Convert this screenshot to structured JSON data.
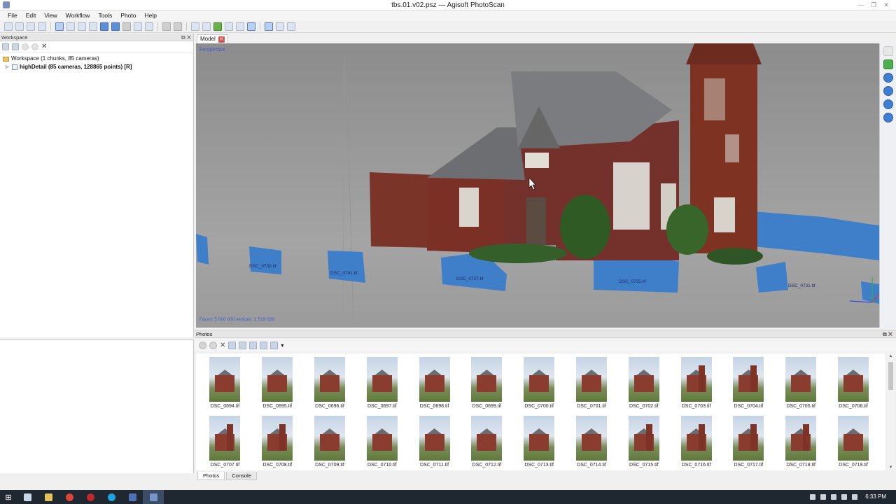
{
  "window": {
    "title": "tbs.01.v02.psz — Agisoft PhotoScan"
  },
  "menu": [
    "File",
    "Edit",
    "View",
    "Workflow",
    "Tools",
    "Photo",
    "Help"
  ],
  "workspace": {
    "panel_title": "Workspace",
    "root_label": "Workspace (1 chunks, 85 cameras)",
    "chunk_label": "highDetail (85 cameras, 128865 points) [R]"
  },
  "model": {
    "tab_label": "Model",
    "projection": "Perspective",
    "stats": "Faces: 5 000 000 vertices: 2 519 089",
    "camera_labels": [
      "DSC_0730.tif",
      "DSC_0741.tif",
      "DSC_0727.tif",
      "DSC_0725.tif",
      "DSC_0721.tif"
    ]
  },
  "photos": {
    "panel_title": "Photos",
    "items": [
      {
        "name": "DSC_0694.tif",
        "tower": false
      },
      {
        "name": "DSC_0695.tif",
        "tower": false
      },
      {
        "name": "DSC_0696.tif",
        "tower": false
      },
      {
        "name": "DSC_0697.tif",
        "tower": false
      },
      {
        "name": "DSC_0698.tif",
        "tower": false
      },
      {
        "name": "DSC_0699.tif",
        "tower": false
      },
      {
        "name": "DSC_0700.tif",
        "tower": false
      },
      {
        "name": "DSC_0701.tif",
        "tower": false
      },
      {
        "name": "DSC_0702.tif",
        "tower": false
      },
      {
        "name": "DSC_0703.tif",
        "tower": true
      },
      {
        "name": "DSC_0704.tif",
        "tower": true
      },
      {
        "name": "DSC_0705.tif",
        "tower": false
      },
      {
        "name": "DSC_0706.tif",
        "tower": false
      },
      {
        "name": "DSC_0707.tif",
        "tower": true
      },
      {
        "name": "DSC_0708.tif",
        "tower": true
      },
      {
        "name": "DSC_0709.tif",
        "tower": false
      },
      {
        "name": "DSC_0710.tif",
        "tower": false
      },
      {
        "name": "DSC_0711.tif",
        "tower": false
      },
      {
        "name": "DSC_0712.tif",
        "tower": false
      },
      {
        "name": "DSC_0713.tif",
        "tower": false
      },
      {
        "name": "DSC_0714.tif",
        "tower": false
      },
      {
        "name": "DSC_0715.tif",
        "tower": true
      },
      {
        "name": "DSC_0716.tif",
        "tower": true
      },
      {
        "name": "DSC_0717.tif",
        "tower": true
      },
      {
        "name": "DSC_0718.tif",
        "tower": true
      },
      {
        "name": "DSC_0719.tif",
        "tower": false
      }
    ]
  },
  "bottom_tabs": {
    "photos": "Photos",
    "console": "Console"
  },
  "taskbar": {
    "clock": "6:33 PM"
  },
  "colors": {
    "camera_plane": "#3f7fc9",
    "brick": "#7a3024",
    "label": "#3b5bd6"
  }
}
